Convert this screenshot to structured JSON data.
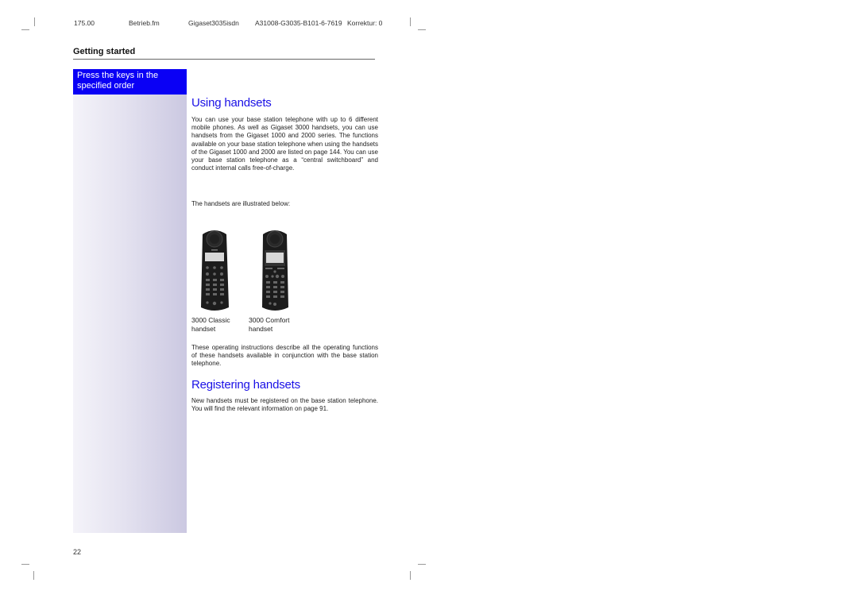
{
  "header": {
    "version": "175.00",
    "file": "Betrieb.fm",
    "product": "Gigaset3035isdn",
    "doc_id": "A31008-G3035-B101-6-7619",
    "correction": "Korrektur: 0"
  },
  "section_title": "Getting started",
  "sidebar": {
    "note": "Press the keys in the specified order",
    "note_line1": "Press the keys in the",
    "note_line2": "specified order",
    "accent_color": "#0a00f5"
  },
  "main": {
    "using_handsets": {
      "title": "Using handsets",
      "body": "You can use your base station telephone with up to 6 different mobile phones. As well as Gigaset 3000 handsets, you can use handsets from the Gigaset 1000 and 2000 series. The functions available on your base station telephone when using the handsets of the Gigaset 1000 and 2000 are listed on page 144. You can use your base station telephone as a “central switchboard” and conduct internal calls free-of-charge.",
      "illustrated": "The handsets are illustrated below:",
      "handsets": [
        {
          "name": "3000 Classic handset",
          "line1": "3000 Classic",
          "line2": "handset"
        },
        {
          "name": "3000 Comfort handset",
          "line1": "3000 Comfort",
          "line2": "handset"
        }
      ],
      "description": "These operating instructions describe all the operating functions of these handsets available in conjunction with the base station telephone."
    },
    "registering_handsets": {
      "title": "Registering handsets",
      "body": "New handsets must be registered on the base station telephone. You will find the relevant information on page 91."
    },
    "heading_color": "#1a10e6"
  },
  "footer": {
    "page_number": "22"
  }
}
